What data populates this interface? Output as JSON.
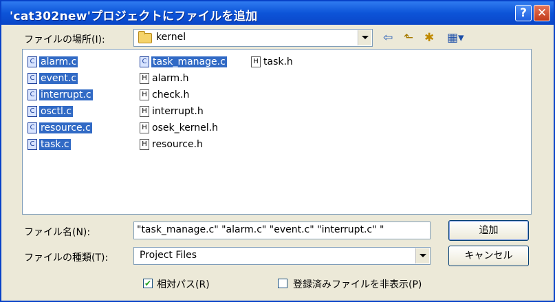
{
  "window": {
    "title": "'cat302new'プロジェクトにファイルを追加",
    "help_label": "?",
    "close_label": "✕"
  },
  "look_in": {
    "label": "ファイルの場所(I):",
    "value": "kernel"
  },
  "toolbar": {
    "back_icon": "⇦",
    "up_icon": "⬑",
    "new_folder_icon": "✱",
    "view_icon": "▦▾"
  },
  "files": [
    {
      "icon": "C",
      "name": "alarm.c"
    },
    {
      "icon": "C",
      "name": "event.c"
    },
    {
      "icon": "C",
      "name": "interrupt.c"
    },
    {
      "icon": "C",
      "name": "osctl.c"
    },
    {
      "icon": "C",
      "name": "resource.c"
    },
    {
      "icon": "C",
      "name": "task.c"
    },
    {
      "icon": "C",
      "name": "task_manage.c"
    },
    {
      "icon": "H",
      "name": "alarm.h"
    },
    {
      "icon": "H",
      "name": "check.h"
    },
    {
      "icon": "H",
      "name": "interrupt.h"
    },
    {
      "icon": "H",
      "name": "osek_kernel.h"
    },
    {
      "icon": "H",
      "name": "resource.h"
    },
    {
      "icon": "H",
      "name": "task.h"
    }
  ],
  "filename": {
    "label": "ファイル名(N):",
    "value": "\"task_manage.c\" \"alarm.c\" \"event.c\" \"interrupt.c\" \""
  },
  "filetype": {
    "label": "ファイルの種類(T):",
    "value": "Project Files"
  },
  "buttons": {
    "add": "追加",
    "cancel": "キャンセル"
  },
  "options": {
    "relative_path": {
      "label": "相対パス(R)",
      "checked": true,
      "mark": "✔"
    },
    "hide_registered": {
      "label": "登録済みファイルを非表示(P)",
      "checked": false
    }
  }
}
